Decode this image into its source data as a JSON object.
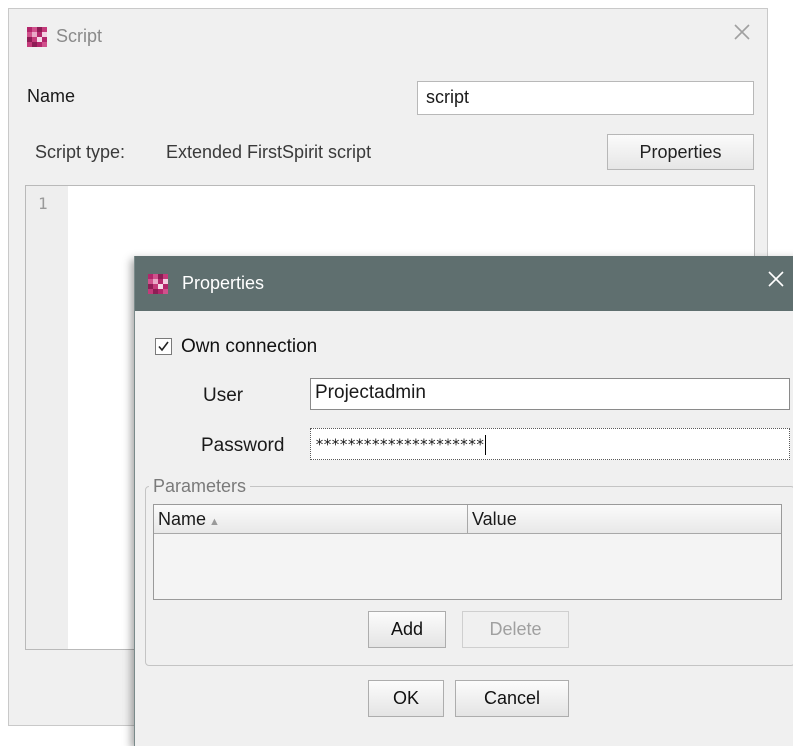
{
  "script_window": {
    "title": "Script",
    "name_label": "Name",
    "name_value": "script",
    "type_label": "Script type:",
    "type_value": "Extended FirstSpirit script",
    "properties_button": "Properties",
    "editor_line_numbers": [
      "1"
    ]
  },
  "properties_dialog": {
    "title": "Properties",
    "own_connection_label": "Own connection",
    "own_connection_checked": true,
    "user_label": "User",
    "user_value": "Projectadmin",
    "password_label": "Password",
    "password_masked": "*********************",
    "parameters": {
      "legend": "Parameters",
      "columns": [
        "Name",
        "Value"
      ],
      "sort_indicator": "▲",
      "rows": []
    },
    "add_button": "Add",
    "delete_button": "Delete",
    "delete_enabled": false,
    "ok_button": "OK",
    "cancel_button": "Cancel"
  },
  "icons": {
    "logo": "firstspirit-logo-icon",
    "close": "close-icon",
    "checkbox": "checkmark-icon"
  },
  "colors": {
    "dialog_titlebar": "#5f6f6f",
    "window_bg": "#f0f0f0",
    "logo_primary": "#b3266b"
  }
}
